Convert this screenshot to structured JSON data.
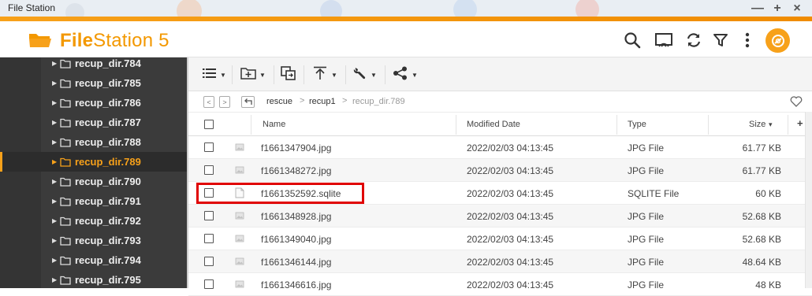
{
  "window": {
    "title": "File Station",
    "controls": [
      "—",
      "+",
      "×"
    ]
  },
  "app": {
    "name_bold": "File",
    "name_rest": "Station 5",
    "accent": "#f39800"
  },
  "header_icons": [
    "search-icon",
    "media-cast-icon",
    "refresh-icon",
    "filter-icon",
    "more-vertical-icon",
    "user-avatar-icon"
  ],
  "sidebar": {
    "items": [
      {
        "label": "recup_dir.784",
        "selected": false
      },
      {
        "label": "recup_dir.785",
        "selected": false
      },
      {
        "label": "recup_dir.786",
        "selected": false
      },
      {
        "label": "recup_dir.787",
        "selected": false
      },
      {
        "label": "recup_dir.788",
        "selected": false
      },
      {
        "label": "recup_dir.789",
        "selected": true
      },
      {
        "label": "recup_dir.790",
        "selected": false
      },
      {
        "label": "recup_dir.791",
        "selected": false
      },
      {
        "label": "recup_dir.792",
        "selected": false
      },
      {
        "label": "recup_dir.793",
        "selected": false
      },
      {
        "label": "recup_dir.794",
        "selected": false
      },
      {
        "label": "recup_dir.795",
        "selected": false
      }
    ]
  },
  "toolbar": {
    "buttons": [
      "list-view-icon",
      "new-folder-icon",
      "copy-icon",
      "upload-icon",
      "tools-icon",
      "share-icon"
    ]
  },
  "breadcrumb": {
    "parts": [
      "rescue",
      "recup1",
      "recup_dir.789"
    ],
    "separator": ">"
  },
  "table": {
    "columns": {
      "name": "Name",
      "modified": "Modified Date",
      "type": "Type",
      "size": "Size",
      "sort_indicator": "▾",
      "add": "+"
    },
    "rows": [
      {
        "name": "f1661347904.jpg",
        "modified": "2022/02/03 04:13:45",
        "type": "JPG File",
        "size": "61.77 KB",
        "icon": "image-file-icon"
      },
      {
        "name": "f1661348272.jpg",
        "modified": "2022/02/03 04:13:45",
        "type": "JPG File",
        "size": "61.77 KB",
        "icon": "image-file-icon"
      },
      {
        "name": "f1661352592.sqlite",
        "modified": "2022/02/03 04:13:45",
        "type": "SQLITE File",
        "size": "60 KB",
        "icon": "generic-file-icon",
        "highlighted": true
      },
      {
        "name": "f1661348928.jpg",
        "modified": "2022/02/03 04:13:45",
        "type": "JPG File",
        "size": "52.68 KB",
        "icon": "image-file-icon"
      },
      {
        "name": "f1661349040.jpg",
        "modified": "2022/02/03 04:13:45",
        "type": "JPG File",
        "size": "52.68 KB",
        "icon": "image-file-icon"
      },
      {
        "name": "f1661346144.jpg",
        "modified": "2022/02/03 04:13:45",
        "type": "JPG File",
        "size": "48.64 KB",
        "icon": "image-file-icon"
      },
      {
        "name": "f1661346616.jpg",
        "modified": "2022/02/03 04:13:45",
        "type": "JPG File",
        "size": "48 KB",
        "icon": "image-file-icon"
      }
    ]
  }
}
